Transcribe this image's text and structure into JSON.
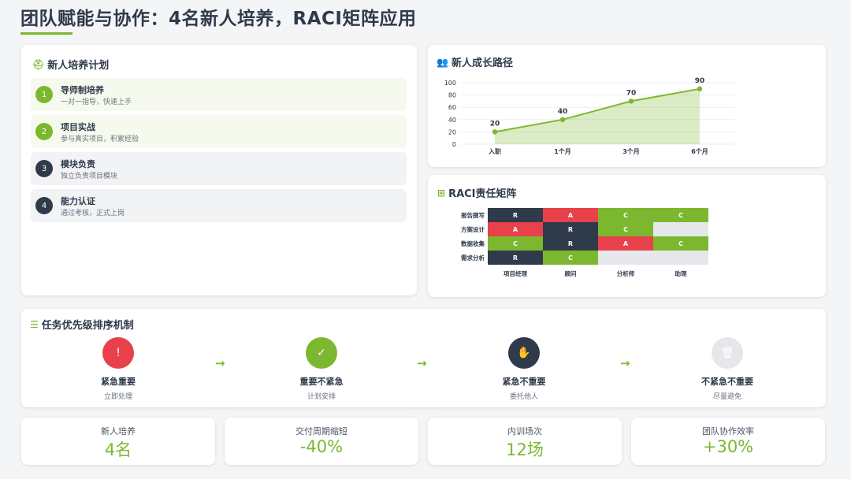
{
  "page_title": "团队赋能与协作：4名新人培养，RACI矩阵应用",
  "colors": {
    "green": "#7cb82f",
    "red": "#e8414c",
    "navy": "#2f3a4a",
    "gray": "#e5e7eb"
  },
  "plan": {
    "title": "新人培养计划",
    "icon": "person-badge-icon",
    "items": [
      {
        "num": "1",
        "name": "导师制培养",
        "desc": "一对一指导，快速上手"
      },
      {
        "num": "2",
        "name": "项目实战",
        "desc": "参与真实项目，积累经验"
      },
      {
        "num": "3",
        "name": "模块负责",
        "desc": "独立负责项目模块"
      },
      {
        "num": "4",
        "name": "能力认证",
        "desc": "通过考核，正式上岗"
      }
    ]
  },
  "growth": {
    "title": "新人成长路径",
    "icon": "users-icon",
    "chart_data": {
      "type": "area",
      "categories": [
        "入职",
        "1个月",
        "3个月",
        "6个月"
      ],
      "values": [
        20,
        40,
        70,
        90
      ],
      "ylim": [
        0,
        100
      ],
      "yticks": [
        0,
        20,
        40,
        60,
        80,
        100
      ],
      "grid": true
    }
  },
  "raci": {
    "title": "RACI责任矩阵",
    "icon": "grid-icon",
    "chart_data": {
      "type": "heatmap",
      "rows": [
        "报告撰写",
        "方案设计",
        "数据收集",
        "需求分析"
      ],
      "columns": [
        "项目经理",
        "顾问",
        "分析师",
        "助理"
      ],
      "cells": [
        [
          "R",
          "A",
          "C",
          "C"
        ],
        [
          "A",
          "R",
          "C",
          ""
        ],
        [
          "C",
          "R",
          "A",
          "C"
        ],
        [
          "R",
          "C",
          "",
          ""
        ]
      ]
    }
  },
  "priority": {
    "title": "任务优先级排序机制",
    "icon": "list-check-icon",
    "steps": [
      {
        "name": "紧急重要",
        "desc": "立即处理",
        "icon": "warning-icon",
        "glyph": "!"
      },
      {
        "name": "重要不紧急",
        "desc": "计划安排",
        "icon": "calendar-check-icon",
        "glyph": "✓"
      },
      {
        "name": "紧急不重要",
        "desc": "委托他人",
        "icon": "hand-icon",
        "glyph": "✋"
      },
      {
        "name": "不紧急不重要",
        "desc": "尽量避免",
        "icon": "trash-icon",
        "glyph": "🗑"
      }
    ],
    "arrow": "→"
  },
  "stats": [
    {
      "label": "新人培养",
      "value": "4名"
    },
    {
      "label": "交付周期缩短",
      "value": "-40%"
    },
    {
      "label": "内训场次",
      "value": "12场"
    },
    {
      "label": "团队协作效率",
      "value": "+30%"
    }
  ]
}
